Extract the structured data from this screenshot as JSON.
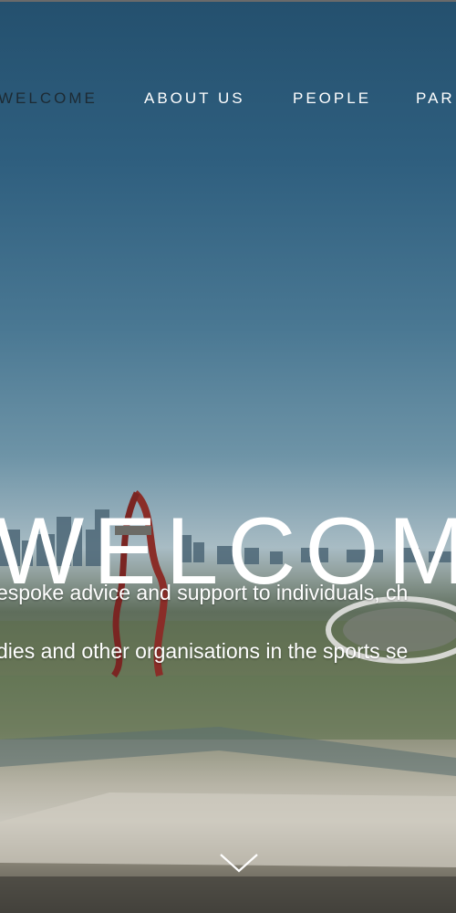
{
  "nav": {
    "items": [
      {
        "label": "WELCOME"
      },
      {
        "label": "ABOUT US"
      },
      {
        "label": "PEOPLE"
      },
      {
        "label": "PAR"
      }
    ]
  },
  "hero": {
    "title": "WELCOM",
    "tagline_line1": "espoke advice and support to individuals, ch",
    "tagline_line2": "dies and other organisations in the sports se"
  },
  "icons": {
    "scroll": "chevron-down-icon"
  }
}
